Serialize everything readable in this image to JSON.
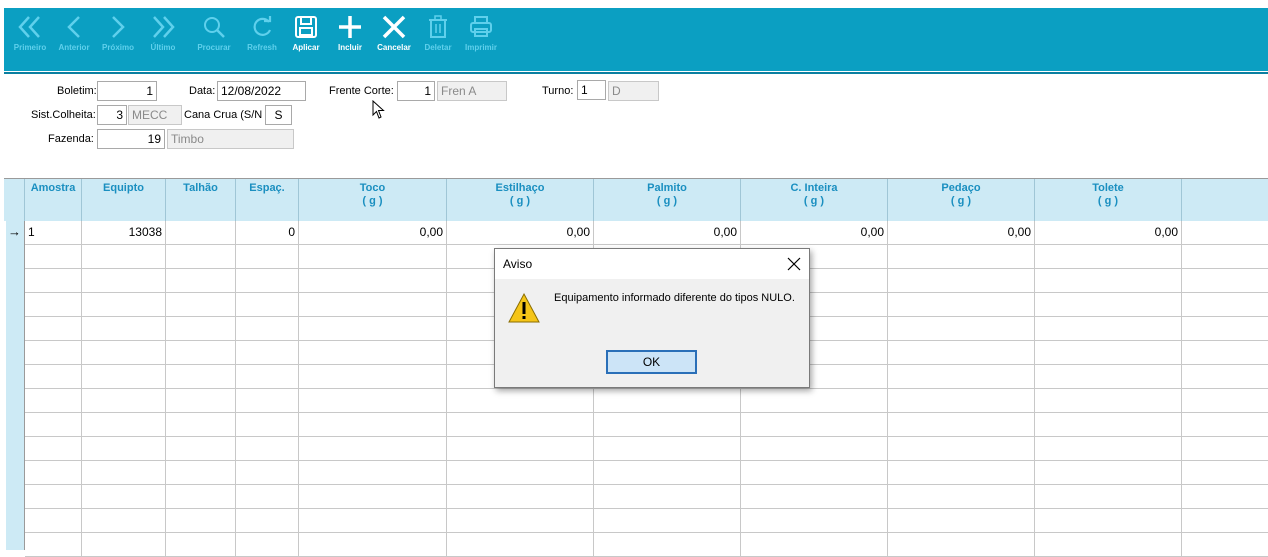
{
  "toolbar": {
    "buttons": [
      {
        "label": "Primeiro",
        "icon": "double-chevron-left-icon",
        "enabled": false
      },
      {
        "label": "Anterior",
        "icon": "chevron-left-icon",
        "enabled": false
      },
      {
        "label": "Próximo",
        "icon": "chevron-right-icon",
        "enabled": false
      },
      {
        "label": "Último",
        "icon": "double-chevron-right-icon",
        "enabled": false
      },
      {
        "label": "Procurar",
        "icon": "search-icon",
        "enabled": false
      },
      {
        "label": "Refresh",
        "icon": "refresh-icon",
        "enabled": false
      },
      {
        "label": "Aplicar",
        "icon": "save-icon",
        "enabled": true
      },
      {
        "label": "Incluir",
        "icon": "plus-icon",
        "enabled": true
      },
      {
        "label": "Cancelar",
        "icon": "close-icon",
        "enabled": true
      },
      {
        "label": "Deletar",
        "icon": "trash-icon",
        "enabled": false
      },
      {
        "label": "Imprimir",
        "icon": "printer-icon",
        "enabled": false
      }
    ]
  },
  "form": {
    "boletim": {
      "label": "Boletim:",
      "value": "1"
    },
    "data": {
      "label": "Data:",
      "value": "12/08/2022"
    },
    "frente_corte": {
      "label": "Frente Corte:",
      "value": "1",
      "desc": "Fren A"
    },
    "turno": {
      "label": "Turno:",
      "value": "1",
      "desc": "D"
    },
    "sist_colheita": {
      "label": "Sist.Colheita:",
      "value": "3",
      "desc": "MECC"
    },
    "cana_crua": {
      "label": "Cana Crua (S/N",
      "value": "S"
    },
    "fazenda": {
      "label": "Fazenda:",
      "value": "19",
      "desc": "Timbo"
    }
  },
  "grid": {
    "columns": [
      {
        "label": "Amostra",
        "unit": ""
      },
      {
        "label": "Equipto",
        "unit": ""
      },
      {
        "label": "Talhão",
        "unit": ""
      },
      {
        "label": "Espaç.",
        "unit": ""
      },
      {
        "label": "Toco",
        "unit": "( g )"
      },
      {
        "label": "Estilhaço",
        "unit": "( g )"
      },
      {
        "label": "Palmito",
        "unit": "( g )"
      },
      {
        "label": "C. Inteira",
        "unit": "( g )"
      },
      {
        "label": "Pedaço",
        "unit": "( g )"
      },
      {
        "label": "Tolete",
        "unit": "( g )"
      },
      {
        "label": "",
        "unit": ""
      }
    ],
    "row_indicator": "→",
    "rows": [
      [
        "1",
        "13038",
        "",
        "0",
        "0,00",
        "0,00",
        "0,00",
        "0,00",
        "0,00",
        "0,00",
        ""
      ]
    ]
  },
  "dialog": {
    "title": "Aviso",
    "message": "Equipamento informado diferente do tipos NULO.",
    "ok_label": "OK",
    "icon": "warning-icon"
  },
  "colors": {
    "toolbar_bg": "#0b9fc2",
    "grid_header_bg": "#cdeaf5",
    "grid_header_text": "#1a8fc0",
    "disabled_label": "#5fd0ec"
  }
}
